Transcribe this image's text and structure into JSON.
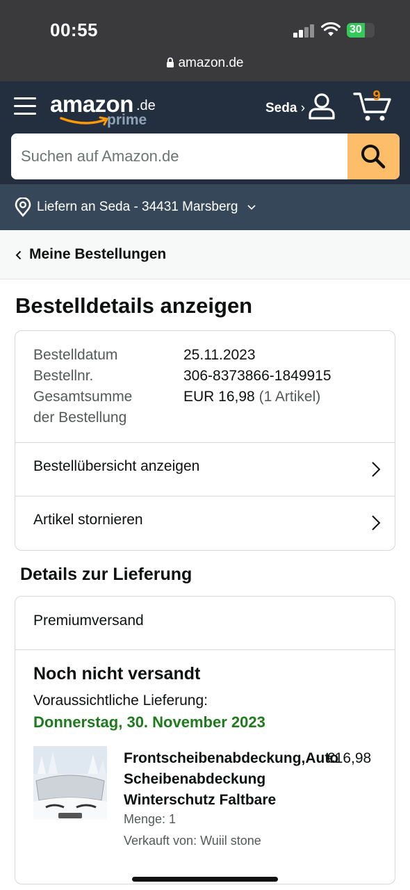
{
  "status_bar": {
    "time": "00:55",
    "battery": "30",
    "url": "amazon.de"
  },
  "header": {
    "logo_word": "amazon",
    "logo_tld": ".de",
    "logo_prime": "prime",
    "account_name": "Seda",
    "account_chevron": "›",
    "cart_count": "9",
    "search_placeholder": "Suchen auf Amazon.de"
  },
  "location": {
    "text": "Liefern an Seda - 34431 Marsberg"
  },
  "breadcrumb": {
    "label": "Meine Bestellungen"
  },
  "page": {
    "title": "Bestelldetails anzeigen"
  },
  "order": {
    "date_label": "Bestelldatum",
    "date_value": "25.11.2023",
    "number_label": "Bestellnr.",
    "number_value": "306-8373866-1849915",
    "total_label_line1": "Gesamtsumme",
    "total_label_line2": "der Bestellung",
    "total_value": "EUR 16,98",
    "total_items": "(1 Artikel)",
    "links": [
      {
        "label": "Bestellübersicht anzeigen"
      },
      {
        "label": "Artikel stornieren"
      }
    ]
  },
  "delivery": {
    "section_title": "Details zur Lieferung",
    "method": "Premiumversand",
    "status": "Noch nicht versandt",
    "eta_label": "Voraussichtliche Lieferung:",
    "eta_date": "Donnerstag, 30. November 2023",
    "product": {
      "title": "Frontscheibenabdeckung,Auto Scheibenabdeckung Winterschutz Faltbare",
      "price": "€16,98",
      "quantity": "Menge: 1",
      "seller": "Verkauft von: Wuiil stone"
    }
  },
  "colors": {
    "header_bg": "#232f3e",
    "location_bg": "#37475a",
    "search_button": "#febd69",
    "cart_count": "#f08804",
    "eta_green": "#1d7a1d"
  },
  "icons": [
    "lock-icon",
    "menu-icon",
    "user-icon",
    "cart-icon",
    "search-icon",
    "location-pin-icon",
    "chevron-down-icon",
    "chevron-left-icon",
    "chevron-right-icon"
  ]
}
